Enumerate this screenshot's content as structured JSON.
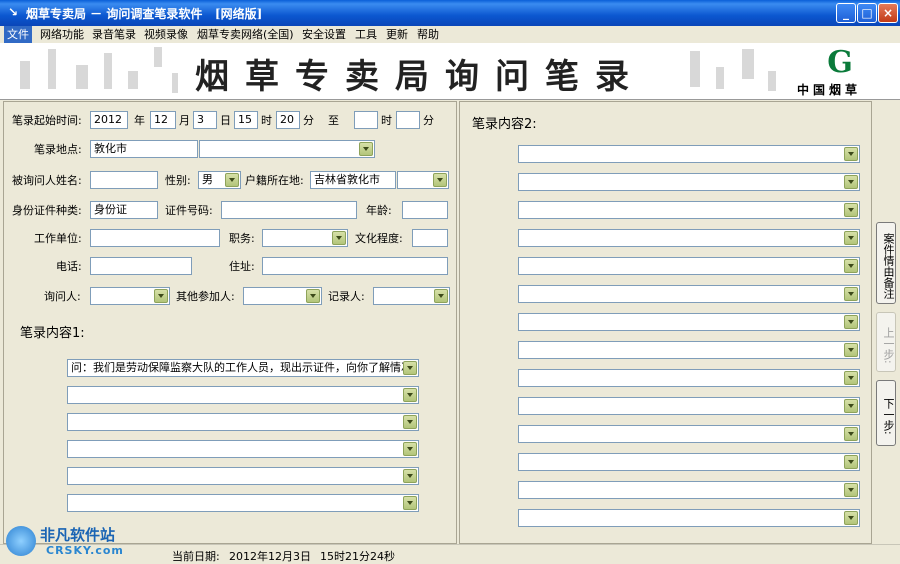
{
  "window": {
    "title": "烟草专卖局 － 询问调查笔录软件   [网络版]"
  },
  "menu": [
    "文件",
    "网络功能",
    "录音笔录",
    "视频录像",
    "烟草专卖网络(全国)",
    "安全设置",
    "工具",
    "更新",
    "帮助"
  ],
  "banner": {
    "heading": "烟草专卖局询问笔录",
    "logo_text": "中国烟草"
  },
  "form": {
    "time_label": "笔录起始时间:",
    "year": "2012",
    "year_unit": "年",
    "month": "12",
    "month_unit": "月",
    "day": "3",
    "day_unit": "日",
    "hour": "15",
    "hour_unit": "时",
    "minute": "20",
    "minute_unit": "分",
    "to_label": "至",
    "end_hour": "",
    "end_hour_unit": "时",
    "end_minute": "",
    "end_minute_unit": "分",
    "location_label": "笔录地点:",
    "location": "敦化市",
    "location2": "",
    "name_label": "被询问人姓名:",
    "name": "",
    "gender_label": "性别:",
    "gender": "男",
    "residence_label": "户籍所在地:",
    "residence": "吉林省敦化市",
    "residence2": "",
    "id_type_label": "身份证件种类:",
    "id_type": "身份证",
    "id_number_label": "证件号码:",
    "id_number": "",
    "age_label": "年龄:",
    "age": "",
    "work_label": "工作单位:",
    "work": "",
    "position_label": "职务:",
    "position": "",
    "education_label": "文化程度:",
    "education": "",
    "phone_label": "电话:",
    "phone": "",
    "address_label": "住址:",
    "address": "",
    "interviewer_label": "询问人:",
    "interviewer": "",
    "others_label": "其他参加人:",
    "others": "",
    "recorder_label": "记录人:",
    "recorder": ""
  },
  "content1": {
    "title": "笔录内容1:",
    "lines": [
      "问：我们是劳动保障监察大队的工作人员，现出示证件，向你了解情况，",
      "",
      "",
      "",
      "",
      ""
    ]
  },
  "content2": {
    "title": "笔录内容2:",
    "lines": [
      "",
      "",
      "",
      "",
      "",
      "",
      "",
      "",
      "",
      "",
      "",
      "",
      "",
      ""
    ]
  },
  "side_buttons": {
    "case": "案件情由备注",
    "prev": "上一步:",
    "next": "下一步:"
  },
  "status": {
    "date_label": "当前日期:",
    "date": "2012年12月3日",
    "time": "15时21分24秒"
  },
  "watermark": {
    "name": "非凡软件站",
    "site": "CRSKY.com"
  },
  "colors": {
    "title_bar": "#0b57d0",
    "menu_active": "#316ac5",
    "window_bg": "#ece9d8"
  }
}
